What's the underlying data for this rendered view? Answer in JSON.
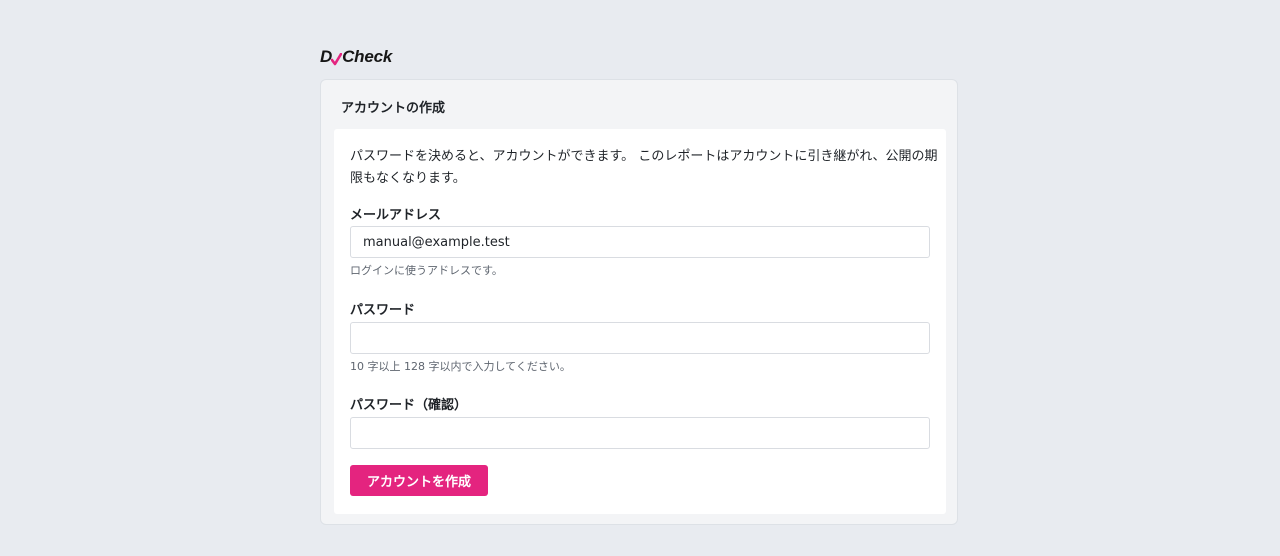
{
  "brand": {
    "prefix": "D",
    "suffix": "Check",
    "accent_color": "#e4247f"
  },
  "card": {
    "title": "アカウントの作成",
    "intro": "パスワードを決めると、アカウントができます。 このレポートはアカウントに引き継がれ、公開の期限もなくなります。"
  },
  "form": {
    "email": {
      "label": "メールアドレス",
      "value": "manual@example.test",
      "hint": "ログインに使うアドレスです。"
    },
    "password": {
      "label": "パスワード",
      "value": "",
      "hint": "10 字以上 128 字以内で入力してください。"
    },
    "password_confirm": {
      "label": "パスワード（確認）",
      "value": ""
    },
    "submit_label": "アカウントを作成",
    "submit_color": "#e4247f"
  }
}
